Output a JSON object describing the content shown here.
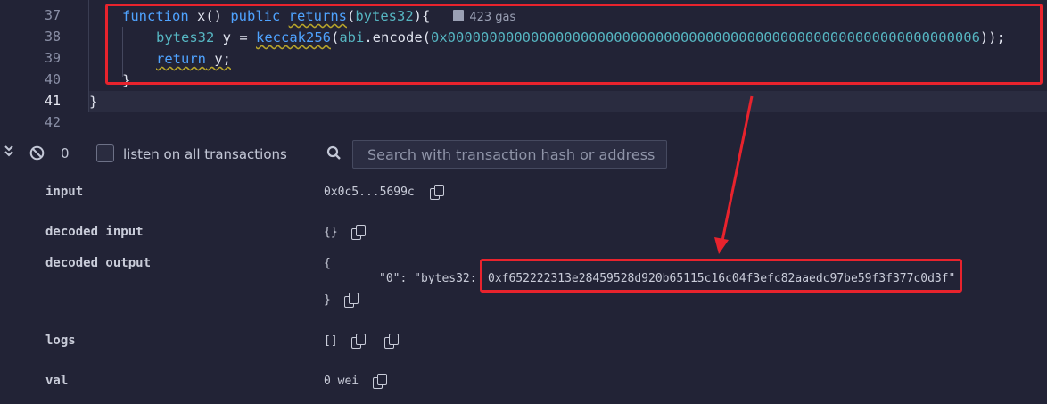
{
  "editor": {
    "line_numbers": [
      "37",
      "38",
      "39",
      "40",
      "41",
      "42"
    ],
    "lines": {
      "l37": {
        "kw_function": "function",
        "fn_name": " x() ",
        "kw_public": "public",
        "kw_returns": "returns",
        "paren_open": "(",
        "type": "bytes32",
        "paren_close": "){",
        "gas": "423 gas"
      },
      "l38": {
        "type": "bytes32",
        "var": " y = ",
        "fn_keccak": "keccak256",
        "paren": "(",
        "abi": "abi",
        "encode": ".encode(",
        "hex": "0x0000000000000000000000000000000000000000000000000000000000000006",
        "close": "));"
      },
      "l39": {
        "kw_return": "return",
        "rest": " y;"
      },
      "l40": {
        "text": "}"
      },
      "l41": {
        "text": "}"
      }
    }
  },
  "terminal": {
    "count": "0",
    "listen_label": "listen on all transactions",
    "search_placeholder": "Search with transaction hash or address"
  },
  "details": {
    "input": {
      "label": "input",
      "value": "0x0c5...5699c"
    },
    "decoded_input": {
      "label": "decoded input",
      "value": "{}"
    },
    "decoded_output": {
      "label": "decoded output",
      "open": "{",
      "entry_key": "\"0\": \"bytes32: ",
      "entry_value": "0xf652222313e28459528d920b65115c16c04f3efc82aaedc97be59f3f377c0d3f\"",
      "close": "}"
    },
    "logs": {
      "label": "logs",
      "value": "[]"
    },
    "val": {
      "label": "val",
      "value": "0 wei"
    }
  },
  "colors": {
    "annotation": "#e8232d",
    "background": "#222336",
    "keyword": "#4fa3ff",
    "type": "#56b6c2"
  },
  "icons": [
    "collapse-icon",
    "clear-icon",
    "search-icon",
    "gas-pump-icon",
    "copy-icon"
  ]
}
